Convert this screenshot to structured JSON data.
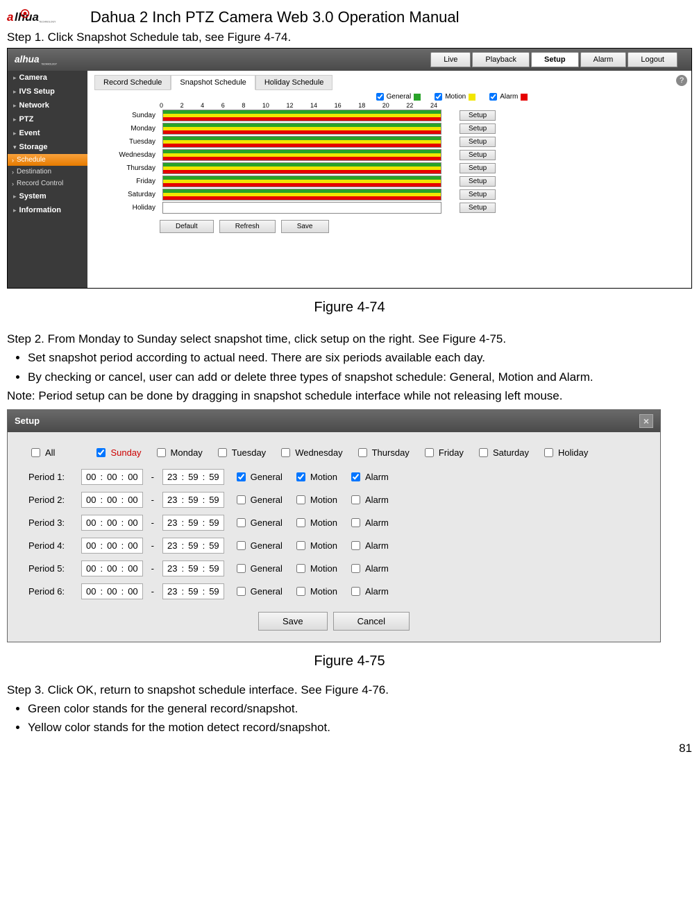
{
  "doc": {
    "title": "Dahua 2 Inch PTZ Camera Web 3.0 Operation Manual",
    "step1": "Step 1. Click Snapshot Schedule tab, see Figure 4-74.",
    "fig74": "Figure 4-74",
    "step2": "Step 2. From Monday to Sunday select snapshot time, click setup on the right. See Figure 4-75.",
    "bullet_a": "Set snapshot period according to actual need. There are six periods available each day.",
    "bullet_b": "By checking or cancel, user can add or delete three types of snapshot schedule: General, Motion and Alarm.",
    "note": "Note: Period setup can be done by dragging in snapshot schedule interface while not releasing left mouse.",
    "fig75": "Figure 4-75",
    "step3": "Step 3. Click OK, return to snapshot schedule interface. See Figure 4-76.",
    "bullet_c": "Green color stands for the general record/snapshot.",
    "bullet_d": "Yellow color stands for the motion detect record/snapshot.",
    "page_num": "81"
  },
  "app1": {
    "top_tabs": [
      "Live",
      "Playback",
      "Setup",
      "Alarm",
      "Logout"
    ],
    "active_top_tab": 2,
    "sidebar": {
      "items": [
        "Camera",
        "IVS Setup",
        "Network",
        "PTZ",
        "Event",
        "Storage",
        "System",
        "Information"
      ],
      "expanded": "Storage",
      "sub": [
        "Schedule",
        "Destination",
        "Record Control"
      ],
      "sub_active": 0
    },
    "subtabs": [
      "Record Schedule",
      "Snapshot Schedule",
      "Holiday Schedule"
    ],
    "subtabs_active": 1,
    "legend": {
      "general": "General",
      "motion": "Motion",
      "alarm": "Alarm",
      "colors": {
        "general": "#29a329",
        "motion": "#f2e600",
        "alarm": "#e60000"
      }
    },
    "hours": [
      "0",
      "2",
      "4",
      "6",
      "8",
      "10",
      "12",
      "14",
      "16",
      "18",
      "20",
      "22",
      "24"
    ],
    "days": [
      "Sunday",
      "Monday",
      "Tuesday",
      "Wednesday",
      "Thursday",
      "Friday",
      "Saturday",
      "Holiday"
    ],
    "setup_label": "Setup",
    "buttons": [
      "Default",
      "Refresh",
      "Save"
    ]
  },
  "dlg": {
    "title": "Setup",
    "all": "All",
    "days": [
      "Sunday",
      "Monday",
      "Tuesday",
      "Wednesday",
      "Thursday",
      "Friday",
      "Saturday",
      "Holiday"
    ],
    "periods": [
      {
        "label": "Period 1:",
        "s": [
          "00",
          "00",
          "00"
        ],
        "e": [
          "23",
          "59",
          "59"
        ],
        "g": true,
        "m": true,
        "a": true
      },
      {
        "label": "Period 2:",
        "s": [
          "00",
          "00",
          "00"
        ],
        "e": [
          "23",
          "59",
          "59"
        ],
        "g": false,
        "m": false,
        "a": false
      },
      {
        "label": "Period 3:",
        "s": [
          "00",
          "00",
          "00"
        ],
        "e": [
          "23",
          "59",
          "59"
        ],
        "g": false,
        "m": false,
        "a": false
      },
      {
        "label": "Period 4:",
        "s": [
          "00",
          "00",
          "00"
        ],
        "e": [
          "23",
          "59",
          "59"
        ],
        "g": false,
        "m": false,
        "a": false
      },
      {
        "label": "Period 5:",
        "s": [
          "00",
          "00",
          "00"
        ],
        "e": [
          "23",
          "59",
          "59"
        ],
        "g": false,
        "m": false,
        "a": false
      },
      {
        "label": "Period 6:",
        "s": [
          "00",
          "00",
          "00"
        ],
        "e": [
          "23",
          "59",
          "59"
        ],
        "g": false,
        "m": false,
        "a": false
      }
    ],
    "type_labels": {
      "general": "General",
      "motion": "Motion",
      "alarm": "Alarm"
    },
    "save": "Save",
    "cancel": "Cancel"
  }
}
